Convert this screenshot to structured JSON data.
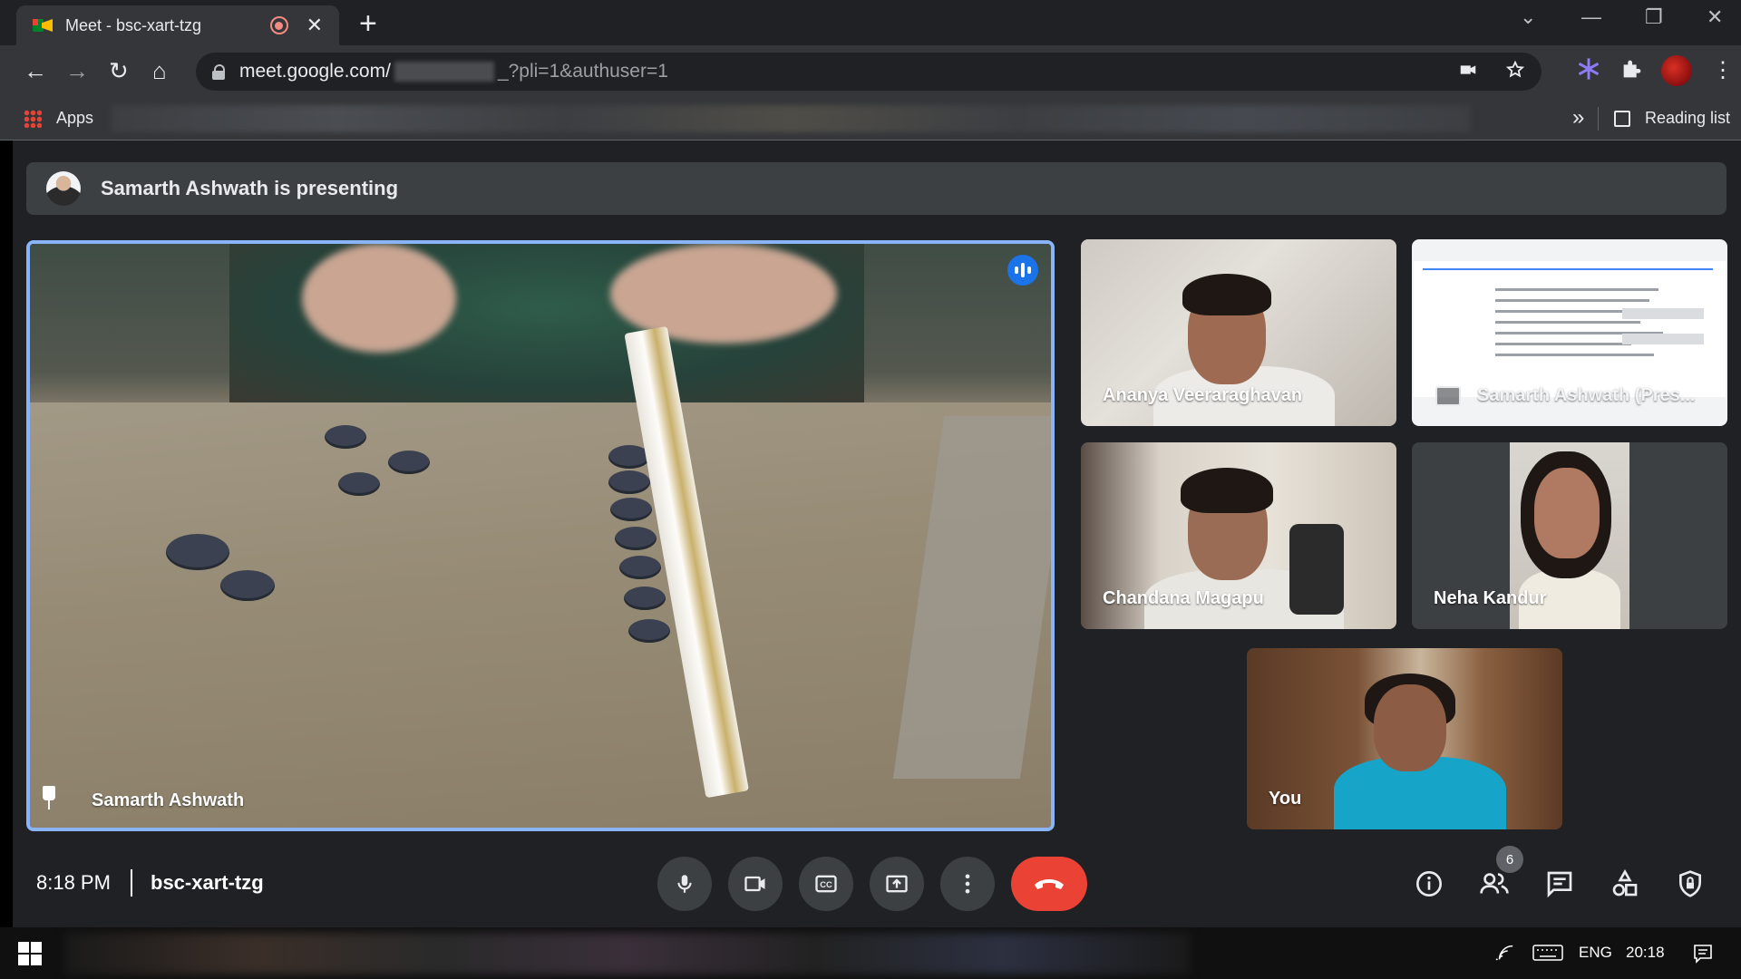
{
  "browser": {
    "tab_title": "Meet - bsc-xart-tzg",
    "tab_close": "✕",
    "new_tab": "+",
    "window_controls": [
      "⌄",
      "—",
      "❐",
      "✕"
    ],
    "url_host": "meet.google.com/",
    "url_rest": "_?pli=1&authuser=1",
    "bookmarks_apps": "Apps",
    "bookmarks_more": "»",
    "reading_list": "Reading list"
  },
  "meeting": {
    "presenting_banner": "Samarth Ashwath is presenting",
    "main_tile_name": "Samarth Ashwath",
    "participants": [
      {
        "name": "Ananya Veeraraghavan"
      },
      {
        "name": "Samarth Ashwath (Pres..."
      },
      {
        "name": "Chandana Magapu"
      },
      {
        "name": "Neha Kandur"
      },
      {
        "name": "You"
      }
    ],
    "time": "8:18 PM",
    "code": "bsc-xart-tzg",
    "participant_count": "6",
    "accent_color": "#8ab4f8",
    "end_call_color": "#ea4335"
  },
  "controls": {
    "icons": [
      "microphone-icon",
      "camera-icon",
      "captions-icon",
      "present-screen-icon",
      "more-options-icon",
      "end-call-icon"
    ],
    "right_icons": [
      "info-icon",
      "people-icon",
      "chat-icon",
      "activities-icon",
      "host-controls-icon"
    ]
  },
  "taskbar": {
    "language": "ENG",
    "clock": "20:18"
  }
}
